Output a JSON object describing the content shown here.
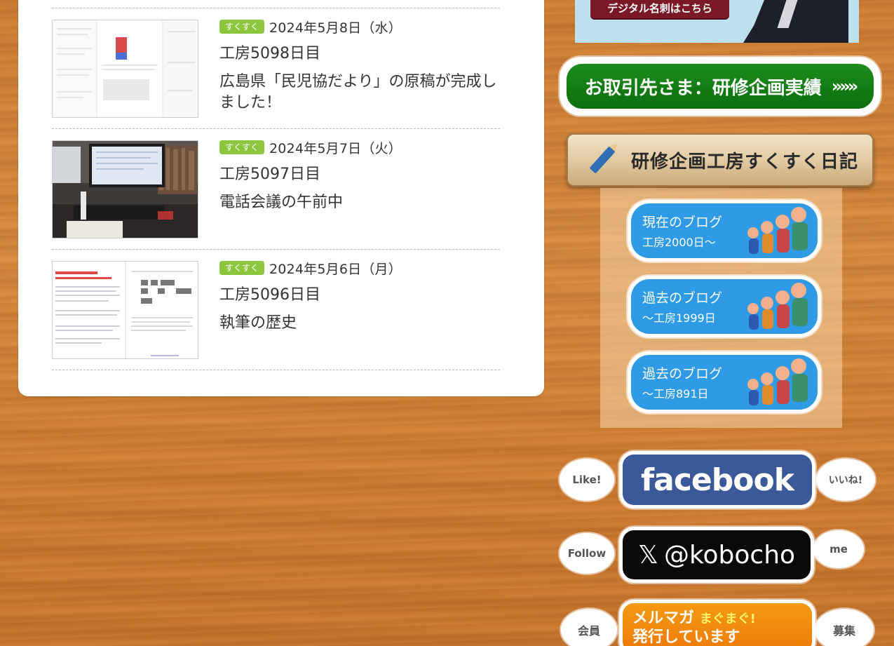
{
  "entries": [
    {
      "tag": "すくすく",
      "date": "2024年5月8日（水）",
      "day": "工房5098日目",
      "excerpt": "広島県「民児協だより」の原稿が完成しました！"
    },
    {
      "tag": "すくすく",
      "date": "2024年5月7日（火）",
      "day": "工房5097日目",
      "excerpt": "電話会議の午前中"
    },
    {
      "tag": "すくすく",
      "date": "2024年5月6日（月）",
      "day": "工房5096日目",
      "excerpt": "執筆の歴史"
    }
  ],
  "sidebar": {
    "meishi_label": "デジタル名刺はこちら",
    "clients_button": "お取引先さま：研修企画実績",
    "clients_arrows": "»»»",
    "diary_title": "研修企画工房すくすく日記",
    "blogs": [
      {
        "line1": "現在のブログ",
        "line2": "工房2000日〜"
      },
      {
        "line1": "過去のブログ",
        "line2": "〜工房1999日"
      },
      {
        "line1": "過去のブログ",
        "line2": "〜工房891日"
      }
    ],
    "facebook": {
      "left": "Like!",
      "main": "facebook",
      "right": "いいね!"
    },
    "x": {
      "left": "Follow",
      "icon": "𝕏",
      "main": "@kobocho",
      "right": "me"
    },
    "mail": {
      "left": "会員",
      "line1": "メルマガ",
      "mag": "まぐまぐ!",
      "line2": "発行しています",
      "right": "募集"
    }
  }
}
